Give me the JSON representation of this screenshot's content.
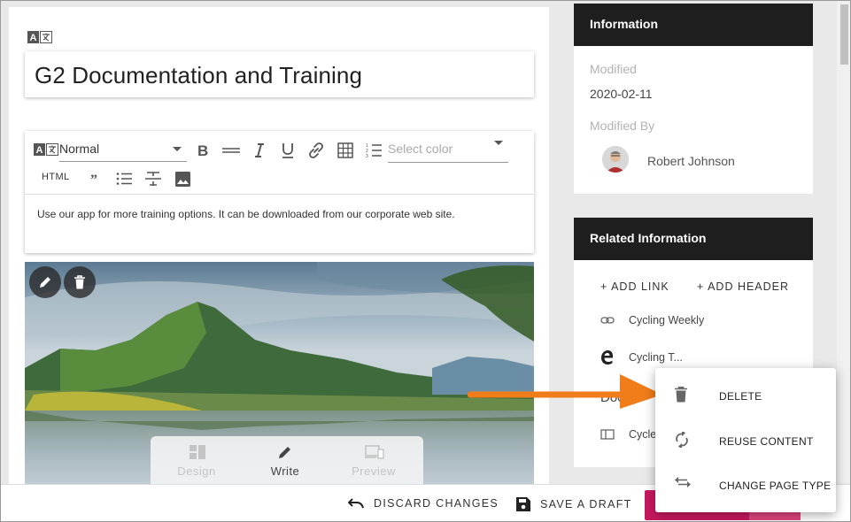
{
  "editor": {
    "title": "G2 Documentation and Training",
    "toolbar": {
      "format_value": "Normal",
      "color_placeholder": "Select color",
      "html_label": "HTML"
    },
    "body_text": "Use our app for more training options. It can be downloaded from our corporate web site."
  },
  "image_block": {
    "modes": [
      "Design",
      "Write",
      "Preview"
    ],
    "active_mode": "Write"
  },
  "information": {
    "heading": "Information",
    "modified_label": "Modified",
    "modified_value": "2020-02-11",
    "modified_by_label": "Modified By",
    "modified_by_value": "Robert Johnson"
  },
  "related": {
    "heading": "Related Information",
    "add_link": "+ ADD LINK",
    "add_header": "+ ADD HEADER",
    "items": [
      {
        "label": "Cycling Weekly",
        "icon": "link-icon"
      },
      {
        "label": "Cycling T...",
        "icon": "edge-browser-icon"
      },
      {
        "label": "Docum",
        "icon": "none"
      },
      {
        "label": "Cycle",
        "icon": "panel-icon"
      }
    ]
  },
  "bottom_bar": {
    "discard": "DISCARD CHANGES",
    "save_draft": "SAVE A DRAFT"
  },
  "context_menu": {
    "items": [
      {
        "label": "DELETE",
        "icon": "trash-icon"
      },
      {
        "label": "REUSE CONTENT",
        "icon": "refresh-icon"
      },
      {
        "label": "CHANGE PAGE TYPE",
        "icon": "swap-icon"
      }
    ]
  },
  "colors": {
    "panel_header": "#1e1e1e",
    "accent_pink": "#c8185f",
    "arrow_orange": "#f07d1a"
  }
}
